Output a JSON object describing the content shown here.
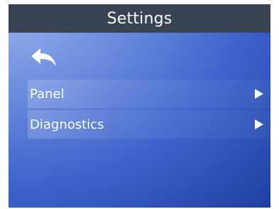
{
  "header": {
    "title": "Settings"
  },
  "toolbar": {
    "back_icon": "back-arrow-icon"
  },
  "menu": {
    "items": [
      {
        "label": "Panel",
        "icon": "chevron-right-icon"
      },
      {
        "label": "Diagnostics",
        "icon": "chevron-right-icon"
      }
    ]
  },
  "colors": {
    "title_bar": "#3a4352",
    "background_light": "#9ab4ec",
    "background_dark": "#1f3f9f",
    "text": "#ffffff"
  }
}
